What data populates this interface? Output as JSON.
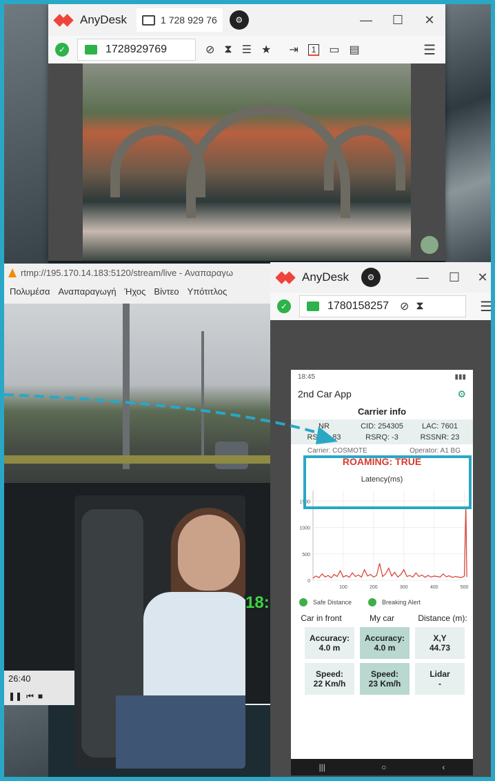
{
  "colors": {
    "frame": "#2aa7c6",
    "anydesk_red": "#ef443b",
    "ok_green": "#2eb24a",
    "roaming_red": "#d63b2f",
    "series_red": "#d63b2f"
  },
  "window1": {
    "app_name": "AnyDesk",
    "tab_label": "1 728 929 76",
    "badge": "⚙",
    "address": "1728929769",
    "toolbar_icons": [
      "screen-share-icon",
      "hourglass-icon",
      "database-icon",
      "star-icon",
      "file-transfer-icon",
      "display-1-icon",
      "monitor-icon",
      "chat-icon"
    ],
    "display_number": "1"
  },
  "vlc": {
    "title": "rtmp://195.170.14.183:5120/stream/live - Αναπαραγω",
    "menu": [
      "Πολυμέσα",
      "Αναπαραγωγή",
      "Ήχος",
      "Βίντεο",
      "Υπότιτλος"
    ],
    "time": "26:40",
    "overlay_text": "18:"
  },
  "window2": {
    "app_name": "AnyDesk",
    "address": "1780158257"
  },
  "phone": {
    "status_time": "18:45",
    "app_title": "2nd Car App",
    "section": "Carrier info",
    "metrics": [
      {
        "label": "NR"
      },
      {
        "label": "CID: 254305"
      },
      {
        "label": "LAC: 7601"
      },
      {
        "label": "RSRP: 83"
      },
      {
        "label": "RSRQ: -3"
      },
      {
        "label": "RSSNR: 23"
      }
    ],
    "carrier": "Carrier: COSMOTE",
    "operator": "Operator: A1 BG",
    "roaming": "ROAMING: TRUE",
    "latency_label": "Latency(ms)",
    "legend": [
      "Safe Distance",
      "Breaking Alert"
    ],
    "columns": [
      "Car in front",
      "My car",
      "Distance (m):"
    ],
    "cards": [
      {
        "title": "Accuracy:",
        "value": "4.0 m"
      },
      {
        "title": "Accuracy:",
        "value": "4.0 m"
      },
      {
        "title": "X,Y",
        "value": "44.73"
      },
      {
        "title": "Speed:",
        "value": "22 Km/h"
      },
      {
        "title": "Speed:",
        "value": "23 Km/h"
      },
      {
        "title": "Lidar",
        "value": "-"
      }
    ],
    "nav": [
      "|||",
      "○",
      "‹"
    ]
  },
  "chart_data": {
    "type": "line",
    "title": "Latency(ms)",
    "xlabel": "",
    "ylabel": "",
    "xlim": [
      0,
      510
    ],
    "ylim": [
      0,
      1700
    ],
    "x_ticks": [
      100,
      200,
      300,
      400,
      500
    ],
    "y_ticks": [
      0,
      500,
      1000,
      1500
    ],
    "series": [
      {
        "values": [
          [
            0,
            40
          ],
          [
            10,
            80
          ],
          [
            20,
            50
          ],
          [
            30,
            120
          ],
          [
            40,
            60
          ],
          [
            50,
            90
          ],
          [
            60,
            45
          ],
          [
            70,
            110
          ],
          [
            80,
            70
          ],
          [
            90,
            180
          ],
          [
            100,
            60
          ],
          [
            110,
            90
          ],
          [
            120,
            55
          ],
          [
            130,
            140
          ],
          [
            140,
            70
          ],
          [
            150,
            100
          ],
          [
            160,
            60
          ],
          [
            170,
            200
          ],
          [
            180,
            80
          ],
          [
            190,
            110
          ],
          [
            200,
            60
          ],
          [
            210,
            90
          ],
          [
            220,
            320
          ],
          [
            230,
            70
          ],
          [
            240,
            120
          ],
          [
            250,
            230
          ],
          [
            260,
            80
          ],
          [
            270,
            150
          ],
          [
            280,
            60
          ],
          [
            290,
            110
          ],
          [
            300,
            200
          ],
          [
            310,
            70
          ],
          [
            320,
            90
          ],
          [
            330,
            60
          ],
          [
            340,
            140
          ],
          [
            350,
            70
          ],
          [
            360,
            100
          ],
          [
            370,
            55
          ],
          [
            380,
            90
          ],
          [
            390,
            60
          ],
          [
            400,
            80
          ],
          [
            410,
            70
          ],
          [
            420,
            60
          ],
          [
            430,
            120
          ],
          [
            440,
            65
          ],
          [
            450,
            85
          ],
          [
            460,
            55
          ],
          [
            470,
            70
          ],
          [
            480,
            60
          ],
          [
            490,
            50
          ],
          [
            500,
            80
          ],
          [
            505,
            1400
          ],
          [
            508,
            60
          ]
        ]
      }
    ]
  }
}
